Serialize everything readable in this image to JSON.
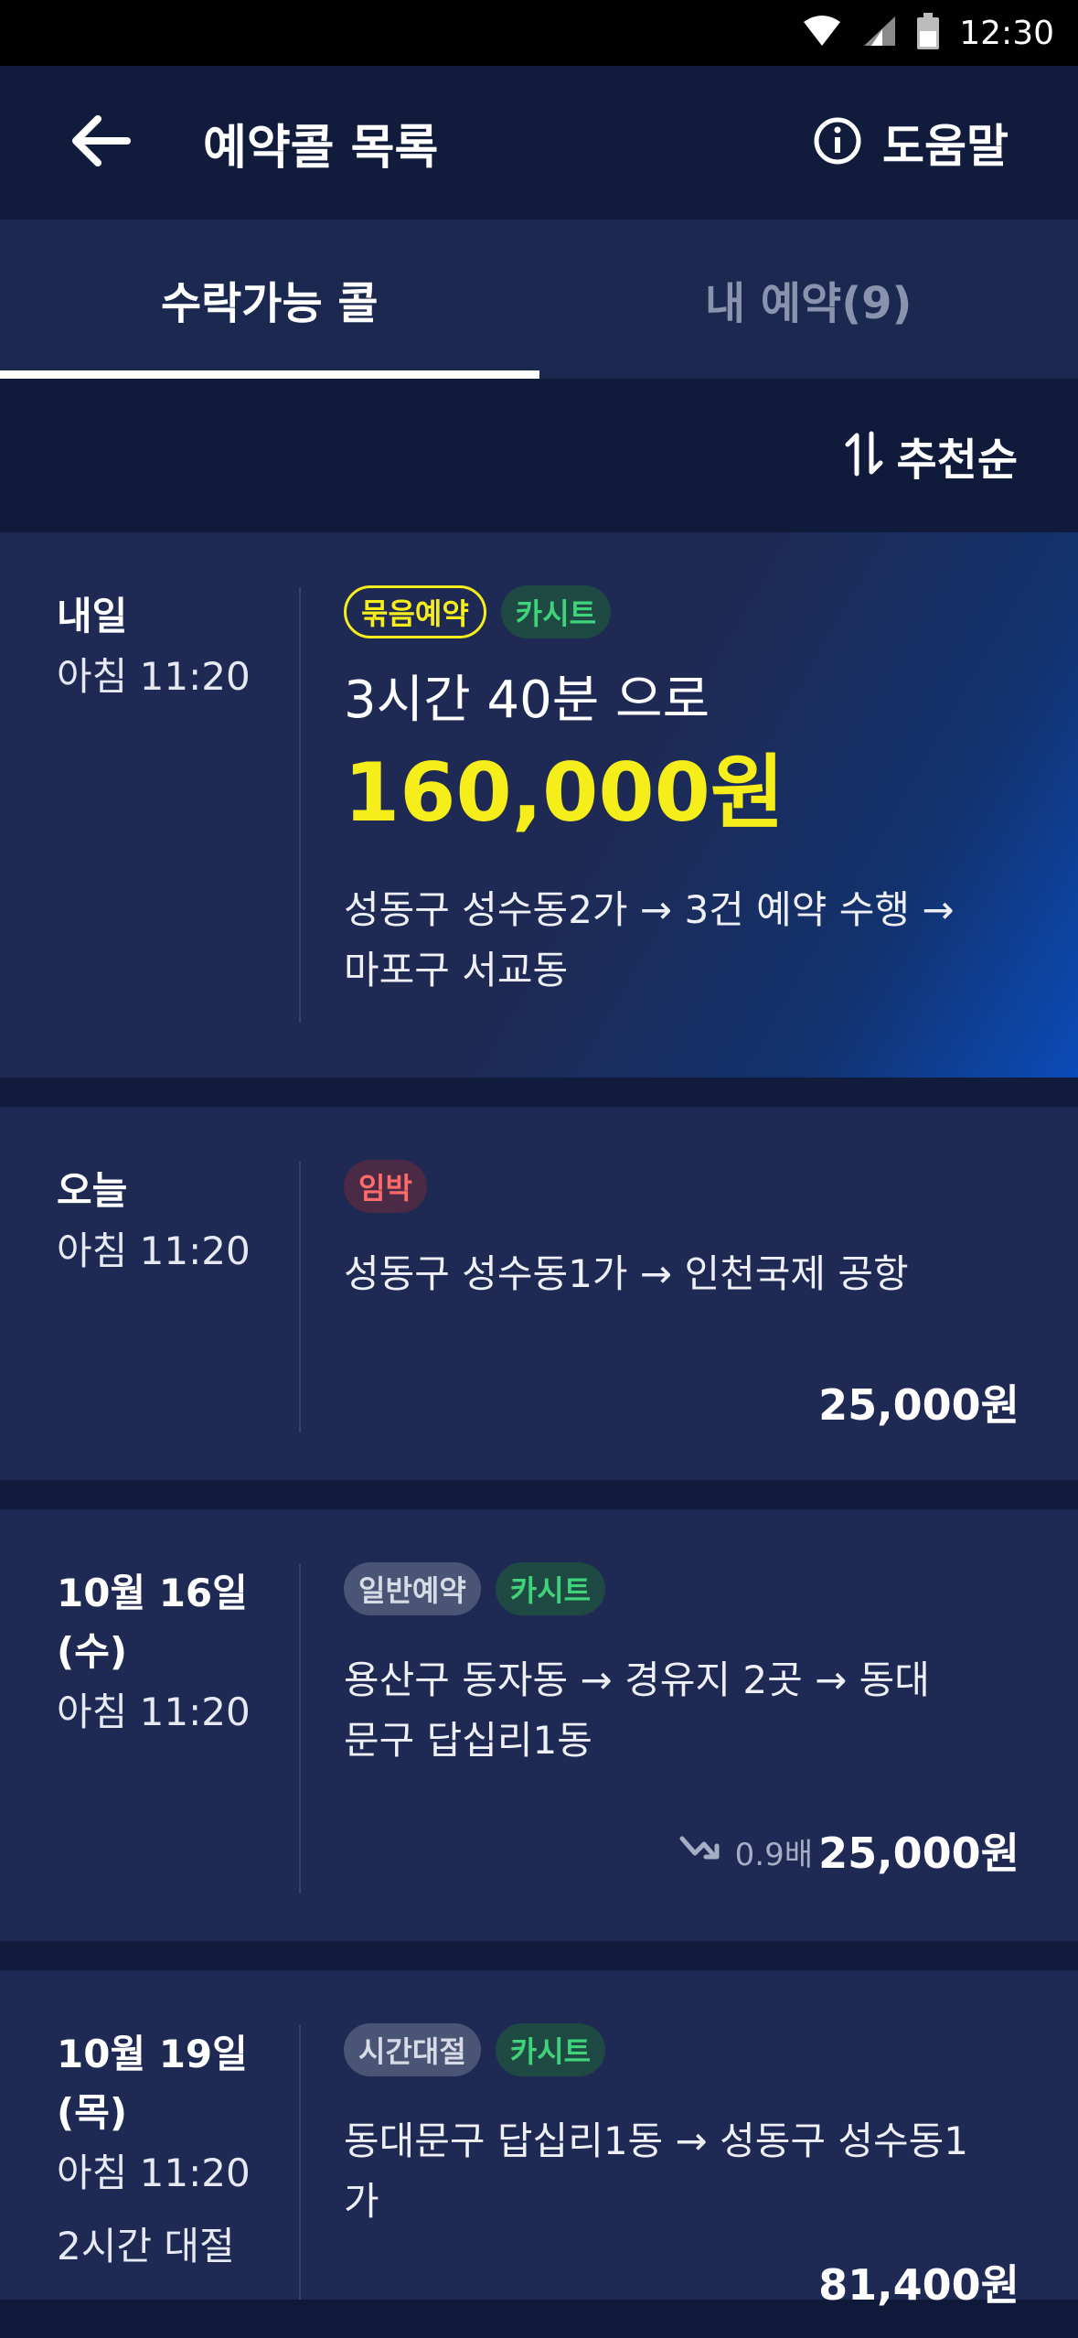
{
  "status_bar": {
    "time": "12:30"
  },
  "app_bar": {
    "title": "예약콜 목록",
    "help_label": "도움말"
  },
  "tabs": [
    {
      "label": "수락가능 콜"
    },
    {
      "label": "내 예약(9)"
    }
  ],
  "sort": {
    "label": "추천순"
  },
  "cards": [
    {
      "day": "내일",
      "time": "아침 11:20",
      "badges": [
        "묶음예약",
        "카시트"
      ],
      "duration": "3시간 40분 으로",
      "price": "160,000원",
      "route_line1": "성동구 성수동2가  →  3건 예약 수행  →",
      "route_line2": "마포구 서교동"
    },
    {
      "day": "오늘",
      "time": "아침 11:20",
      "badges": [
        "임박"
      ],
      "route_line1": "성동구 성수동1가  →  인천국제 공항",
      "price": "25,000원"
    },
    {
      "day_line1": "10월 16일",
      "day_line2": "(수)",
      "time": "아침 11:20",
      "badges": [
        "일반예약",
        "카시트"
      ],
      "route_line1": "용산구 동자동  →  경유지 2곳  →  동대",
      "route_line2": "문구 답십리1동",
      "multiplier": "0.9배",
      "price": "25,000원"
    },
    {
      "day_line1": "10월 19일",
      "day_line2": "(목)",
      "time": "아침 11:20",
      "extra": "2시간 대절",
      "badges": [
        "시간대절",
        "카시트"
      ],
      "route_line1": "동대문구 답십리1동  →  성동구 성수동1",
      "route_line2": "가",
      "price": "81,400원"
    }
  ],
  "colors": {
    "accent_yellow": "#f6ee1b",
    "badge_green": "#3fd37a",
    "badge_red": "#ff6a6a",
    "background": "#1e2a54"
  }
}
